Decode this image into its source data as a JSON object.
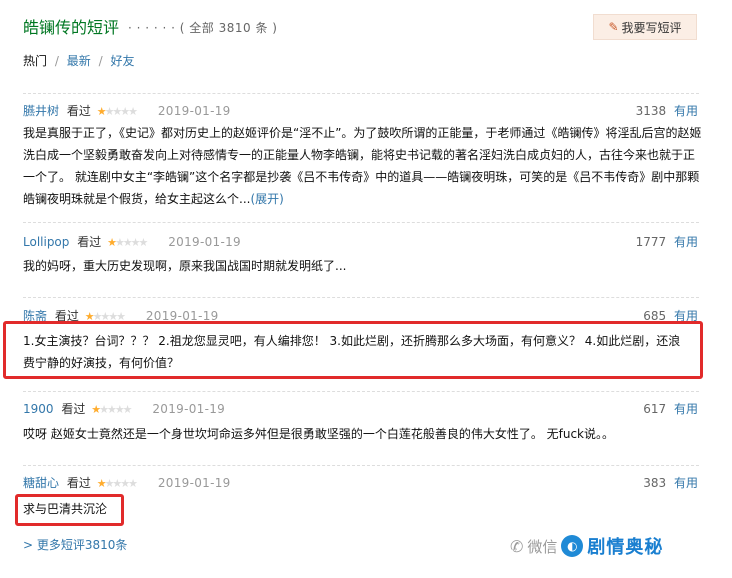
{
  "header": {
    "title": "皓镧传的短评",
    "subtitle": "· · · · · · ( 全部 3810 条 )",
    "write_button": "我要写短评"
  },
  "tabs": {
    "active": "热门",
    "sep": "/",
    "newest": "最新",
    "friends": "好友"
  },
  "comments": [
    {
      "user": "臙井树",
      "watched": "看过",
      "rating": 1,
      "date": "2019-01-19",
      "votes": "3138",
      "useful": "有用",
      "text": "我是真服于正了，《史记》都对历史上的赵姬评价是“淫不止”。为了鼓吹所谓的正能量，于老师通过《皓镧传》将淫乱后宫的赵姬洗白成一个坚毅勇敢奋发向上对待感情专一的正能量人物李皓镧，能将史书记载的著名淫妇洗白成贞妇的人，古往今来也就于正一个了。 就连剧中女主“李皓镧”这个名字都是抄袭《吕不韦传奇》中的道具——皓镧夜明珠，可笑的是《吕不韦传奇》剧中那颗皓镧夜明珠就是个假货，给女主起这么个...",
      "expand": "(展开)"
    },
    {
      "user": "Lollipop",
      "watched": "看过",
      "rating": 1,
      "date": "2019-01-19",
      "votes": "1777",
      "useful": "有用",
      "text": "我的妈呀，重大历史发现啊，原来我国战国时期就发明纸了..."
    },
    {
      "user": "陈斋",
      "watched": "看过",
      "rating": 1,
      "date": "2019-01-19",
      "votes": "685",
      "useful": "有用",
      "text": "1.女主演技？台词？？？ 2.祖龙您显灵吧，有人编排您！ 3.如此烂剧，还折腾那么多大场面，有何意义？ 4.如此烂剧，还浪费宁静的好演技，有何价值？"
    },
    {
      "user": "1900",
      "watched": "看过",
      "rating": 1,
      "date": "2019-01-19",
      "votes": "617",
      "useful": "有用",
      "text": "哎呀 赵姬女士竟然还是一个身世坎坷命运多舛但是很勇敢坚强的一个白莲花般善良的伟大女性了。 无fuck说。。"
    },
    {
      "user": "糖甜心",
      "watched": "看过",
      "rating": 1,
      "date": "2019-01-19",
      "votes": "383",
      "useful": "有用",
      "text": "求与巴清共沉沦"
    }
  ],
  "more_link": "> 更多短评3810条",
  "watermark": {
    "icon": "wechat-icon",
    "text": "微信",
    "brand": "剧情奥秘"
  },
  "colors": {
    "title_green": "#007722",
    "link_blue": "#3377aa",
    "star": "#ffac2d",
    "highlight_red": "#e12a2a"
  }
}
